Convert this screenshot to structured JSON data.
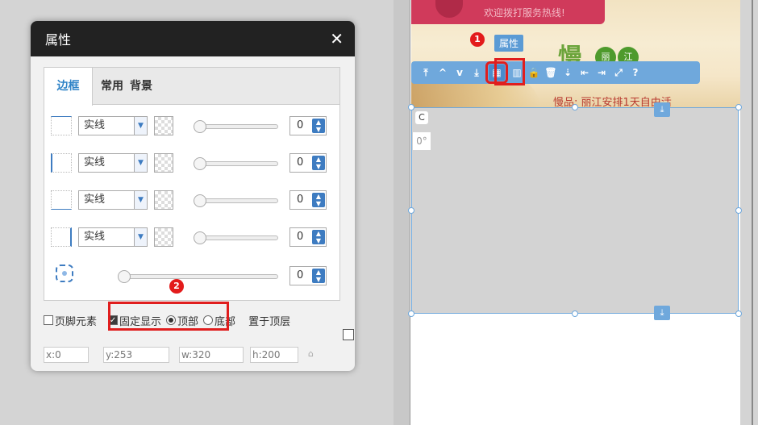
{
  "dialog": {
    "title": "属性",
    "close_glyph": "✕",
    "tabs": [
      {
        "label": "边框",
        "active": true
      },
      {
        "label": "常用",
        "active": false
      },
      {
        "label": "背景",
        "active": false
      }
    ],
    "border_rows": [
      {
        "side": "top",
        "style": "实线",
        "width": "0"
      },
      {
        "side": "left",
        "style": "实线",
        "width": "0"
      },
      {
        "side": "bottom",
        "style": "实线",
        "width": "0"
      },
      {
        "side": "right",
        "style": "实线",
        "width": "0"
      }
    ],
    "radius_value": "0",
    "options": {
      "footer_element": "页脚元素",
      "fixed_display": "固定显示",
      "top": "顶部",
      "bottom": "底部",
      "bring_to_top": "置于顶层"
    },
    "coords": {
      "x_label": "x:",
      "x": "0",
      "y_label": "y:",
      "y": "253",
      "w_label": "w:",
      "w": "320",
      "h_label": "h:",
      "h": "200"
    }
  },
  "canvas": {
    "banner_text": "欢迎拨打服务热线!",
    "banner_big": "慢",
    "banner_circle_1": "丽",
    "banner_circle_2": "江",
    "banner_sub": "慢品: 丽江安排1天自由活",
    "attr_tag": "属性",
    "rotate_glyph": "C",
    "degree": "0°",
    "anchor_glyph": "⤓"
  },
  "badges": {
    "one": "1",
    "two": "2"
  },
  "toolbar": {
    "buttons": [
      "⤒",
      "^",
      "v",
      "⤓",
      "▦",
      "▥",
      "🔒",
      "🗑",
      "⇣",
      "⇤",
      "⇥",
      "⤢",
      "?"
    ]
  },
  "colors": {
    "accent": "#3e7cc1",
    "highlight": "#e01e1e",
    "toolbar": "#6fa8dc"
  }
}
